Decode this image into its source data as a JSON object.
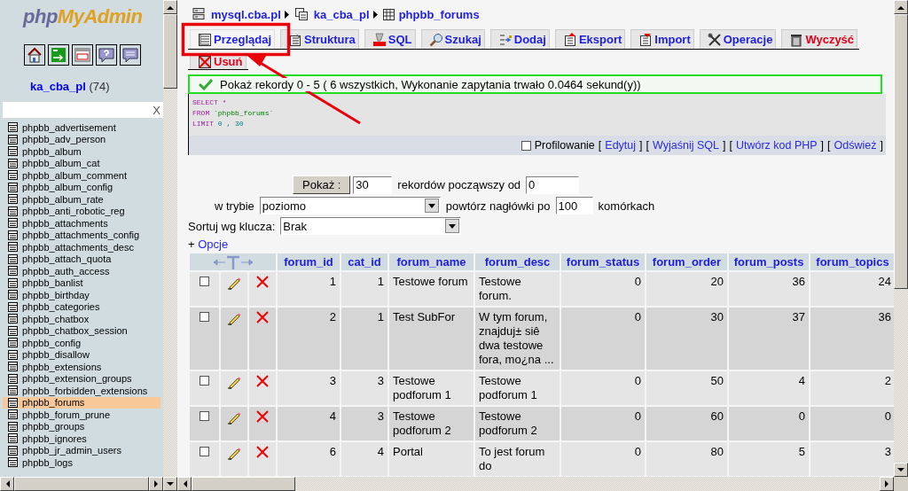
{
  "logo": {
    "part_1": "php",
    "part_2": "MyAdmin"
  },
  "database": {
    "name": "ka_cba_pl",
    "count": "(74)"
  },
  "filter": {
    "clear": "X"
  },
  "tables": [
    {
      "name": "phpbb_advertisement",
      "selected": false
    },
    {
      "name": "phpbb_adv_person",
      "selected": false
    },
    {
      "name": "phpbb_album",
      "selected": false
    },
    {
      "name": "phpbb_album_cat",
      "selected": false
    },
    {
      "name": "phpbb_album_comment",
      "selected": false
    },
    {
      "name": "phpbb_album_config",
      "selected": false
    },
    {
      "name": "phpbb_album_rate",
      "selected": false
    },
    {
      "name": "phpbb_anti_robotic_reg",
      "selected": false
    },
    {
      "name": "phpbb_attachments",
      "selected": false
    },
    {
      "name": "phpbb_attachments_config",
      "selected": false
    },
    {
      "name": "phpbb_attachments_desc",
      "selected": false
    },
    {
      "name": "phpbb_attach_quota",
      "selected": false
    },
    {
      "name": "phpbb_auth_access",
      "selected": false
    },
    {
      "name": "phpbb_banlist",
      "selected": false
    },
    {
      "name": "phpbb_birthday",
      "selected": false
    },
    {
      "name": "phpbb_categories",
      "selected": false
    },
    {
      "name": "phpbb_chatbox",
      "selected": false
    },
    {
      "name": "phpbb_chatbox_session",
      "selected": false
    },
    {
      "name": "phpbb_config",
      "selected": false
    },
    {
      "name": "phpbb_disallow",
      "selected": false
    },
    {
      "name": "phpbb_extensions",
      "selected": false
    },
    {
      "name": "phpbb_extension_groups",
      "selected": false
    },
    {
      "name": "phpbb_forbidden_extensions",
      "selected": false
    },
    {
      "name": "phpbb_forums",
      "selected": true
    },
    {
      "name": "phpbb_forum_prune",
      "selected": false
    },
    {
      "name": "phpbb_groups",
      "selected": false
    },
    {
      "name": "phpbb_ignores",
      "selected": false
    },
    {
      "name": "phpbb_jr_admin_users",
      "selected": false
    },
    {
      "name": "phpbb_logs",
      "selected": false
    }
  ],
  "breadcrumb": [
    {
      "kind": "server",
      "label": "mysql.cba.pl"
    },
    {
      "kind": "database",
      "label": "ka_cba_pl"
    },
    {
      "kind": "table",
      "label": "phpbb_forums"
    }
  ],
  "tabs": [
    {
      "kind": "browse",
      "label": "Przeglądaj",
      "selected": true
    },
    {
      "kind": "structure",
      "label": "Struktura",
      "selected": false
    },
    {
      "kind": "sql",
      "label": "SQL",
      "selected": false
    },
    {
      "kind": "search",
      "label": "Szukaj",
      "selected": false
    },
    {
      "kind": "insert",
      "label": "Dodaj",
      "selected": false
    },
    {
      "kind": "export",
      "label": "Eksport",
      "selected": false
    },
    {
      "kind": "import",
      "label": "Import",
      "selected": false
    },
    {
      "kind": "operations",
      "label": "Operacje",
      "selected": false
    },
    {
      "kind": "empty",
      "label": "Wyczyść",
      "selected": false
    }
  ],
  "tabs_row_2": [
    {
      "kind": "drop",
      "label": "Usuń",
      "selected": false
    }
  ],
  "message": {
    "text": "Pokaż rekordy 0 - 5 ( 6 wszystkich, Wykonanie zapytania trwało 0.0464 sekund(y))"
  },
  "sql": [
    [
      {
        "kind": "keyword",
        "text": "SELECT"
      },
      {
        "kind": "keyword",
        "text": "*"
      }
    ],
    [
      {
        "kind": "keyword",
        "text": "FROM"
      },
      {
        "kind": "name",
        "text": "`phpbb_forums`"
      }
    ],
    [
      {
        "kind": "keyword",
        "text": "LIMIT"
      },
      {
        "kind": "number",
        "text": "0 , 30"
      }
    ]
  ],
  "profiling": {
    "label": "Profilowanie",
    "checked": false,
    "bracket_open": "[",
    "bracket_close": "]"
  },
  "links": [
    {
      "label": "Edytuj"
    },
    {
      "label": "Wyjaśnij SQL"
    },
    {
      "label": "Utwórz kod PHP"
    },
    {
      "label": "Odśwież"
    }
  ],
  "navigation": {
    "show_button": "Pokaż :",
    "rows": "30",
    "rows_label": "rekordów począwszy od",
    "start": "0",
    "mode_label": "w trybie",
    "mode": "poziomo",
    "repeat_label": "powtórz nagłówki po",
    "repeat": "100",
    "repeat_unit": "komórkach",
    "sort_label": "Sortuj wg klucza:",
    "sort": "Brak"
  },
  "options": {
    "prefix": "+",
    "label": "Opcje"
  },
  "table": {
    "columns": [
      {
        "label": "forum_id",
        "kind": "number"
      },
      {
        "label": "cat_id",
        "kind": "number"
      },
      {
        "label": "forum_name",
        "kind": "text"
      },
      {
        "label": "forum_desc",
        "kind": "text"
      },
      {
        "label": "forum_status",
        "kind": "number"
      },
      {
        "label": "forum_order",
        "kind": "number"
      },
      {
        "label": "forum_posts",
        "kind": "number"
      },
      {
        "label": "forum_topics",
        "kind": "number"
      }
    ],
    "rows": [
      {
        "checked": false,
        "cells": [
          "1",
          "1",
          "Testowe forum",
          "Testowe forum.",
          "0",
          "20",
          "36",
          "24"
        ]
      },
      {
        "checked": false,
        "cells": [
          "2",
          "1",
          "Test SubFor",
          "W tym forum, znajduj± siê dwa testowe fora, mo¿na ...",
          "0",
          "30",
          "37",
          "36"
        ]
      },
      {
        "checked": false,
        "cells": [
          "3",
          "3",
          "Testowe podforum 1",
          "Testowe podforum 1",
          "0",
          "50",
          "4",
          "2"
        ]
      },
      {
        "checked": false,
        "cells": [
          "4",
          "3",
          "Testowe podforum 2",
          "Testowe podforum 2",
          "0",
          "60",
          "0",
          "0"
        ]
      },
      {
        "checked": false,
        "cells": [
          "6",
          "4",
          "Portal",
          "To jest forum do",
          "0",
          "80",
          "5",
          "3"
        ]
      }
    ]
  }
}
